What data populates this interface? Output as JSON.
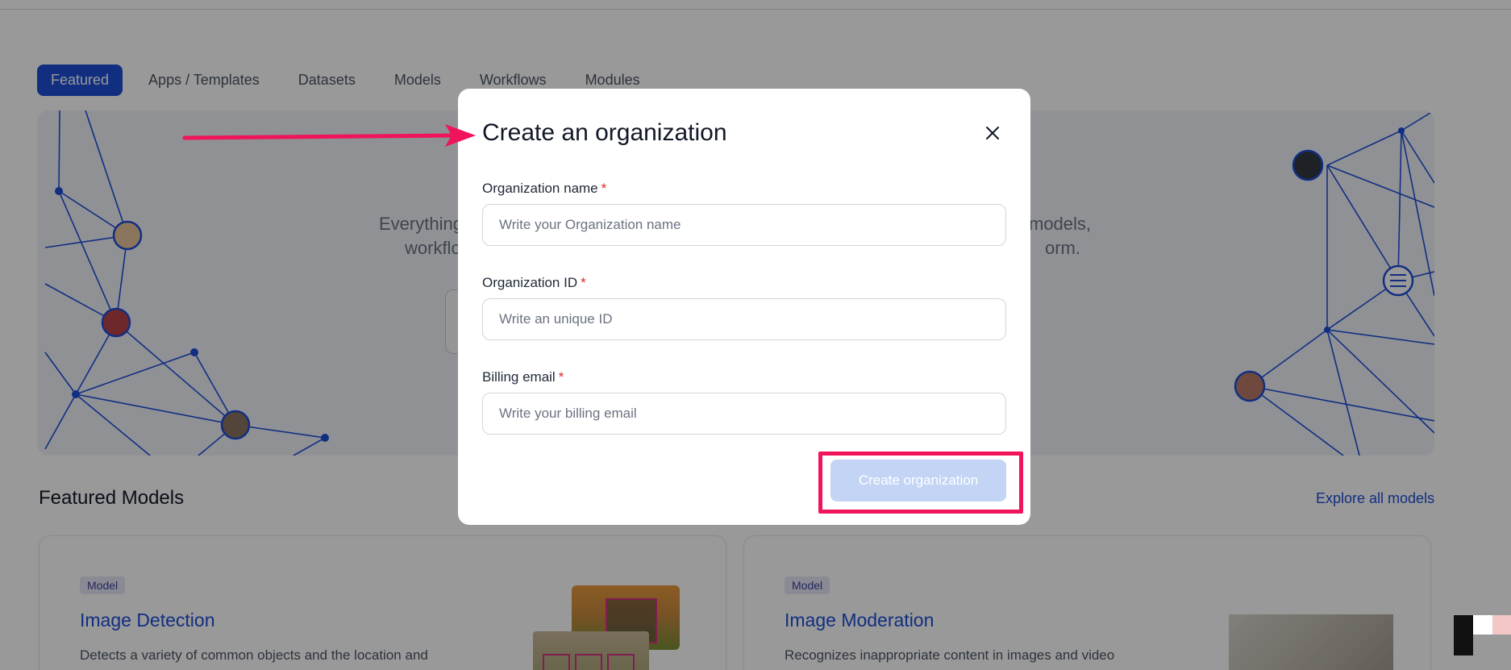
{
  "tabs": [
    {
      "label": "Featured",
      "active": true
    },
    {
      "label": "Apps / Templates",
      "active": false
    },
    {
      "label": "Datasets",
      "active": false
    },
    {
      "label": "Models",
      "active": false
    },
    {
      "label": "Workflows",
      "active": false
    },
    {
      "label": "Modules",
      "active": false
    }
  ],
  "hero": {
    "text_left_line1": "Everything",
    "text_left_line2": "workflo",
    "text_right_line1": "models,",
    "text_right_line2": "orm."
  },
  "featured_models": {
    "title": "Featured Models",
    "explore_link": "Explore all models",
    "cards": [
      {
        "badge": "Model",
        "title": "Image Detection",
        "description": "Detects a variety of common objects and the location and"
      },
      {
        "badge": "Model",
        "title": "Image Moderation",
        "description": "Recognizes inappropriate content in images and video"
      }
    ]
  },
  "modal": {
    "title": "Create an organization",
    "close_icon": "close-icon",
    "fields": {
      "org_name": {
        "label": "Organization name",
        "required_mark": "*",
        "placeholder": "Write your Organization name"
      },
      "org_id": {
        "label": "Organization ID",
        "required_mark": "*",
        "placeholder": "Write an unique ID"
      },
      "billing_email": {
        "label": "Billing email",
        "required_mark": "*",
        "placeholder": "Write your billing email"
      }
    },
    "submit_label": "Create organization"
  },
  "colors": {
    "accent": "#1d4ed8",
    "annotation": "#f0145a",
    "button_disabled": "#c3d4f5"
  }
}
